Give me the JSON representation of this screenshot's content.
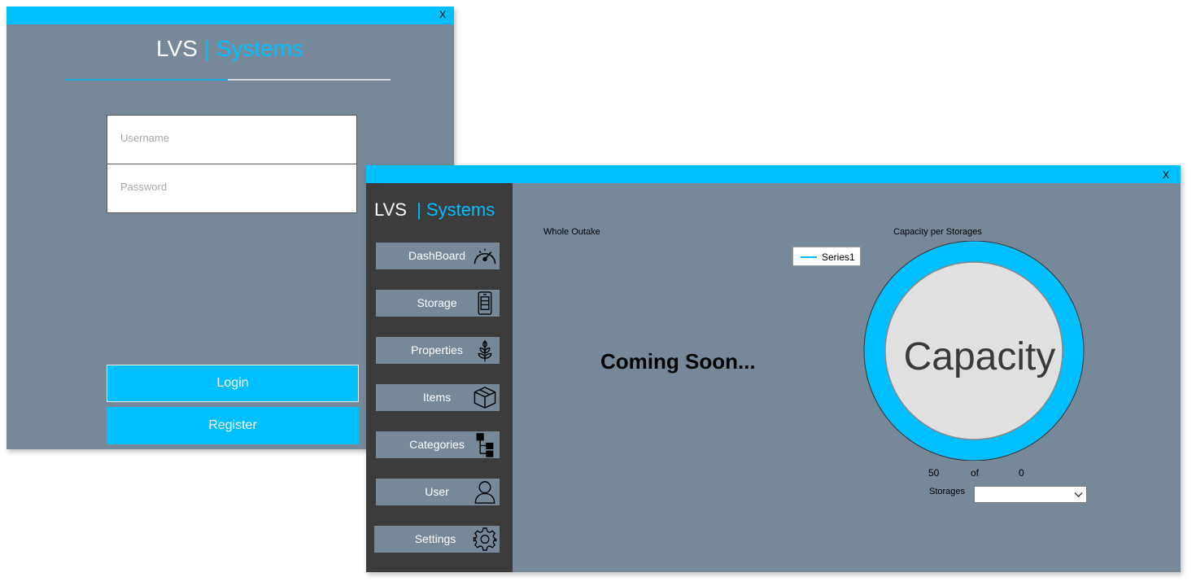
{
  "login_window": {
    "close_label": "X",
    "brand": {
      "part1": "LVS",
      "part2": "| Systems"
    },
    "username": {
      "placeholder": "Username"
    },
    "password": {
      "placeholder": "Password"
    },
    "login_label": "Login",
    "register_label": "Register"
  },
  "main_window": {
    "close_label": "X",
    "brand": {
      "part1": "LVS",
      "part2": "| Systems"
    },
    "nav": [
      {
        "label": "DashBoard",
        "icon": "speedometer-icon"
      },
      {
        "label": "Storage",
        "icon": "storage-cabinet-icon"
      },
      {
        "label": "Properties",
        "icon": "plant-icon"
      },
      {
        "label": "Items",
        "icon": "box-icon"
      },
      {
        "label": "Categories",
        "icon": "hierarchy-icon"
      },
      {
        "label": "User",
        "icon": "user-icon"
      },
      {
        "label": "Settings",
        "icon": "gear-icon"
      }
    ],
    "whole_outake_label": "Whole Outake",
    "legend_series": "Series1",
    "coming_soon": "Coming Soon...",
    "capacity_label": "Capacity per Storages",
    "capacity_center_text": "Capacity",
    "capacity_used": "50",
    "of_label": "of",
    "capacity_total": "0",
    "storages_label": "Storages",
    "storages_selected": ""
  },
  "colors": {
    "accent": "#00bfff",
    "panel": "#778899",
    "sidebar": "#3c3c3c",
    "donut_inner": "#e0e0e0"
  }
}
